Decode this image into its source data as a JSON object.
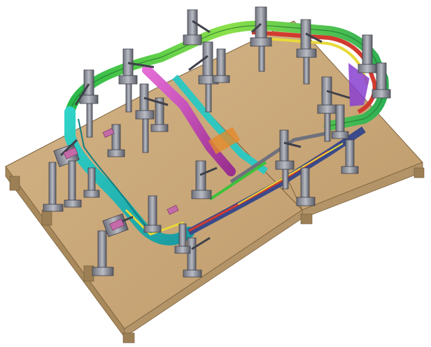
{
  "scene": {
    "subject": "welding-fixture-cad-render",
    "view": "isometric",
    "colors": {
      "background": "#ffffff",
      "base_plate": "#c8a87a",
      "base_plate_edge": "#8a6f48",
      "base_side": "#a88a5e",
      "clamp_metal": "#8d8f9a",
      "clamp_dark": "#4b4d57",
      "frame_green": "#3cc23a",
      "frame_cyan": "#2fc7c0",
      "frame_magenta": "#d04fc0",
      "frame_yellow": "#e8d93a",
      "frame_red": "#d23a2f",
      "frame_orange": "#e38a2a",
      "frame_purple": "#8a3fd0"
    }
  }
}
